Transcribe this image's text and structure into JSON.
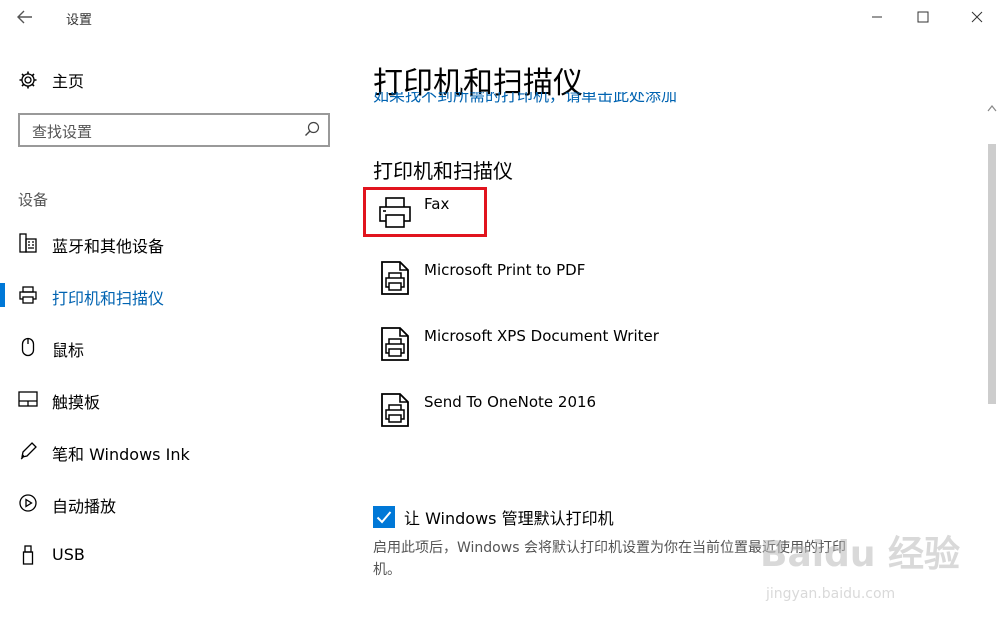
{
  "window": {
    "title": "设置"
  },
  "sidebar": {
    "home_label": "主页",
    "search_placeholder": "查找设置",
    "section_title": "设备",
    "items": [
      {
        "label": "蓝牙和其他设备",
        "icon": "keyboard-icon"
      },
      {
        "label": "打印机和扫描仪",
        "icon": "printer-icon",
        "active": true
      },
      {
        "label": "鼠标",
        "icon": "mouse-icon"
      },
      {
        "label": "触摸板",
        "icon": "touchpad-icon"
      },
      {
        "label": "笔和 Windows Ink",
        "icon": "pen-icon"
      },
      {
        "label": "自动播放",
        "icon": "autoplay-icon"
      },
      {
        "label": "USB",
        "icon": "usb-icon"
      }
    ]
  },
  "main": {
    "page_title": "打印机和扫描仪",
    "clipped_link": "如果找不到所需的打印机，请单击此处添加",
    "sub_title": "打印机和扫描仪",
    "devices": [
      {
        "name": "Fax",
        "icon": "fax-printer-icon"
      },
      {
        "name": "Microsoft Print to PDF",
        "icon": "document-printer-icon"
      },
      {
        "name": "Microsoft XPS Document Writer",
        "icon": "document-printer-icon"
      },
      {
        "name": "Send To OneNote 2016",
        "icon": "document-printer-icon"
      }
    ],
    "default_printer": {
      "checked": true,
      "label": "让 Windows 管理默认打印机",
      "description": "启用此项后，Windows 会将默认打印机设置为你在当前位置最近使用的打印机。"
    }
  },
  "watermark": {
    "logo": "Baidu 经验",
    "url": "jingyan.baidu.com"
  },
  "colors": {
    "accent": "#0078d7",
    "active_text": "#0063b1",
    "highlight": "#e1141e"
  }
}
